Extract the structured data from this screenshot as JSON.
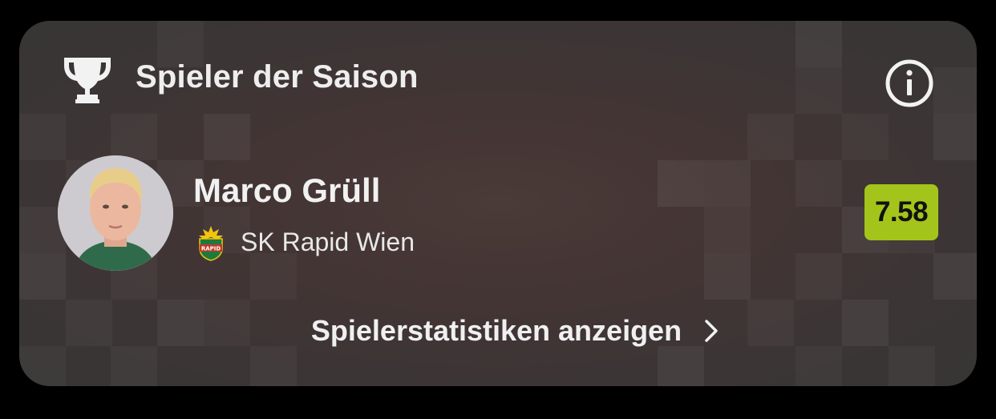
{
  "widget": {
    "title": "Spieler der Saison",
    "icon": "trophy-icon",
    "info_icon": "info-icon"
  },
  "player": {
    "name": "Marco Grüll",
    "club": "SK Rapid Wien",
    "club_logo_text": "RAPID",
    "rating": "7.58"
  },
  "link": {
    "label": "Spielerstatistiken anzeigen",
    "icon": "chevron-right-icon"
  },
  "colors": {
    "rating_badge": "#a3c41a",
    "card_background": "#3d3535",
    "text": "#f0f0f0"
  }
}
